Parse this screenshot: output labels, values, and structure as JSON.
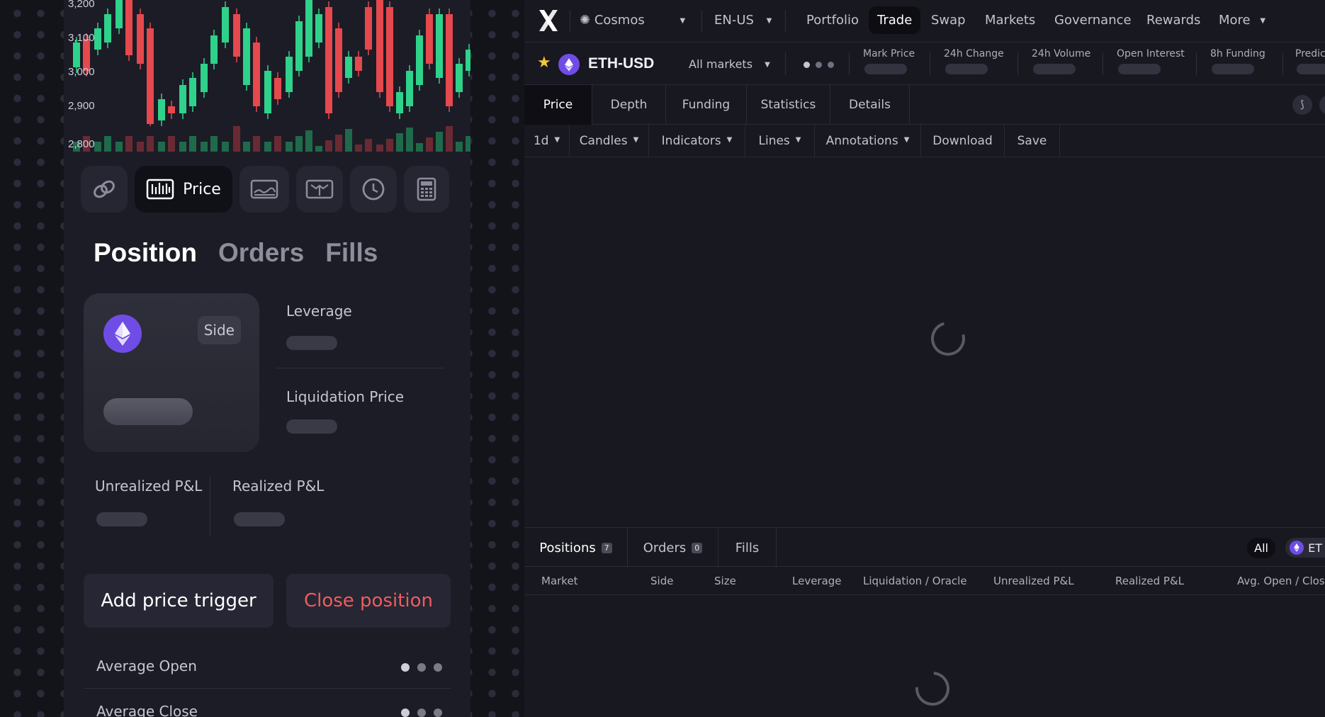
{
  "mini_chart": {
    "y_ticks": [
      "3,200",
      "3,100",
      "3,000",
      "2,900",
      "2,800"
    ],
    "up_color": "#2fd28b",
    "down_color": "#e5484d"
  },
  "toolbar": {
    "price_label": "Price",
    "icons": [
      "link-icon",
      "candles-icon",
      "depth-icon",
      "funding-icon",
      "clock-icon",
      "calculator-icon"
    ]
  },
  "position_tabs": [
    "Position",
    "Orders",
    "Fills"
  ],
  "position_card": {
    "side_label": "Side",
    "leverage_label": "Leverage",
    "liquidation_label": "Liquidation Price",
    "unrealized_label": "Unrealized P&L",
    "realized_label": "Realized P&L"
  },
  "actions": {
    "add_trigger": "Add price trigger",
    "close_position": "Close position"
  },
  "details": {
    "avg_open": "Average Open",
    "avg_close": "Average Close"
  },
  "nav": {
    "network": "Cosmos",
    "locale": "EN-US",
    "links": [
      "Portfolio",
      "Trade",
      "Swap",
      "Markets",
      "Governance",
      "Rewards",
      "More"
    ],
    "active": "Trade"
  },
  "market": {
    "name": "ETH-USD",
    "selector": "All markets",
    "stats": [
      "Mark Price",
      "24h Change",
      "24h Volume",
      "Open Interest",
      "8h Funding",
      "Predic"
    ]
  },
  "chart_tabs": [
    "Price",
    "Depth",
    "Funding",
    "Statistics",
    "Details"
  ],
  "chart_toolbar": [
    "1d",
    "Candles",
    "Indicators",
    "Lines",
    "Annotations",
    "Download",
    "Save"
  ],
  "bottom_tabs": {
    "positions": "Positions",
    "positions_count": "7",
    "orders": "Orders",
    "orders_count": "0",
    "fills": "Fills",
    "filter_all": "All",
    "filter_market": "ET"
  },
  "table_headers": [
    "Market",
    "Side",
    "Size",
    "Leverage",
    "Liquidation / Oracle",
    "Unrealized P&L",
    "Realized P&L",
    "Avg. Open / Close"
  ],
  "colors": {
    "accent_purple": "#6f4ce6",
    "danger": "#f05c5c",
    "favorite": "#f7c53a"
  }
}
